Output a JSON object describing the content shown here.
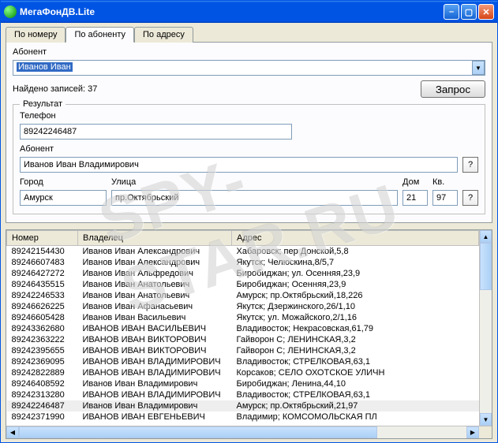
{
  "window": {
    "title": "МегаФонДВ.Lite"
  },
  "tabs": [
    {
      "label": "По номеру"
    },
    {
      "label": "По абоненту"
    },
    {
      "label": "По адресу"
    }
  ],
  "abonent_label": "Абонент",
  "abonent_value": "Иванов Иван",
  "status_text": "Найдено записей: 37",
  "request_button": "Запрос",
  "group_title": "Результат",
  "phone_label": "Телефон",
  "phone_value": "89242246487",
  "sub_label": "Абонент",
  "sub_value": "Иванов Иван Владимирович",
  "city_label": "Город",
  "city_value": "Амурск",
  "street_label": "Улица",
  "street_value": "пр.Октябрьский",
  "house_label": "Дом",
  "house_value": "21",
  "apt_label": "Кв.",
  "apt_value": "97",
  "q_mark": "?",
  "columns": {
    "number": "Номер",
    "owner": "Владелец",
    "address": "Адрес"
  },
  "rows": [
    {
      "n": "89242154430",
      "o": "Иванов Иван Александрович",
      "a": "Хабаровск; пер Донской,5,8"
    },
    {
      "n": "89246607483",
      "o": "Иванов Иван Александрович",
      "a": "Якутск; Челюскина,8/5,7"
    },
    {
      "n": "89246427272",
      "o": "Иванов Иван Альфредович",
      "a": "Биробиджан; ул. Осенняя,23,9"
    },
    {
      "n": "89246435515",
      "o": "Иванов Иван Анатольевич",
      "a": "Биробиджан; Осенняя,23,9"
    },
    {
      "n": "89242246533",
      "o": "Иванов Иван Анатольевич",
      "a": "Амурск; пр.Октябрьский,18,226"
    },
    {
      "n": "89246626225",
      "o": "Иванов Иван Афанасьевич",
      "a": "Якутск; Дзержинского,26/1,10"
    },
    {
      "n": "89246605428",
      "o": "Иванов Иван Васильевич",
      "a": "Якутск; ул. Можайского,2/1,16"
    },
    {
      "n": "89243362680",
      "o": "ИВАНОВ ИВАН ВАСИЛЬЕВИЧ",
      "a": "Владивосток; Некрасовская,61,79"
    },
    {
      "n": "89242363222",
      "o": "ИВАНОВ ИВАН ВИКТОРОВИЧ",
      "a": "Гайворон С; ЛЕНИНСКАЯ,3,2"
    },
    {
      "n": "89242395655",
      "o": "ИВАНОВ ИВАН ВИКТОРОВИЧ",
      "a": "Гайворон С; ЛЕНИНСКАЯ,3,2"
    },
    {
      "n": "89242369095",
      "o": "ИВАНОВ ИВАН ВЛАДИМИРОВИЧ",
      "a": "Владивосток; СТРЕЛКОВАЯ,63,1"
    },
    {
      "n": "89242822889",
      "o": "ИВАНОВ ИВАН ВЛАДИМИРОВИЧ",
      "a": "Корсаков; СЕЛО ОХОТСКОЕ УЛИЧН"
    },
    {
      "n": "89246408592",
      "o": "Иванов Иван Владимирович",
      "a": "Биробиджан; Ленина,44,10"
    },
    {
      "n": "89242313280",
      "o": "ИВАНОВ ИВАН ВЛАДИМИРОВИЧ",
      "a": "Владивосток; СТРЕЛКОВАЯ,63,1"
    },
    {
      "n": "89242246487",
      "o": "Иванов Иван Владимирович",
      "a": "Амурск; пр.Октябрьский,21,97",
      "hl": 1
    },
    {
      "n": "89242371990",
      "o": "ИВАНОВ ИВАН ЕВГЕНЬЕВИЧ",
      "a": "Владимир; КОМСОМОЛЬСКАЯ ПЛ"
    }
  ],
  "watermark": "SPY-STAR.RU"
}
